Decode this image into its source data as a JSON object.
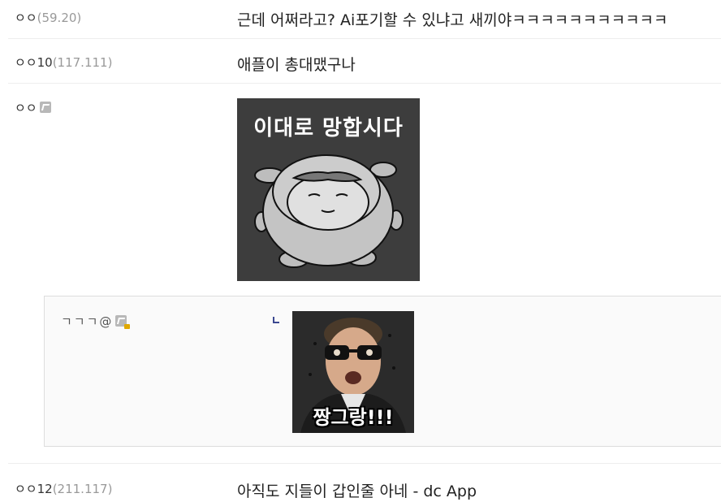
{
  "comments": [
    {
      "nick": "ㅇㅇ",
      "ip": "(59.20)",
      "text": "근데 어쩌라고? Ai포기할 수 있냐고 새끼야ㅋㅋㅋㅋㅋㅋㅋㅋㅋㅋㅋ"
    },
    {
      "nick": "ㅇㅇ10",
      "ip": "(117.111)",
      "text": "애플이 총대맸구나"
    },
    {
      "nick": "ㅇㅇ",
      "icon": "gallog-icon",
      "dccon_caption": "이대로 망합시다"
    },
    {
      "nick": "ㅇㅇ12",
      "ip": "(211.117)",
      "text": "아직도 지들이 갑인줄 아네 - dc App"
    }
  ],
  "reply": {
    "nick": "ㄱㄱㄱ@",
    "icon": "gallog-locked-icon",
    "dccon_caption": "짱그랑!!!"
  }
}
